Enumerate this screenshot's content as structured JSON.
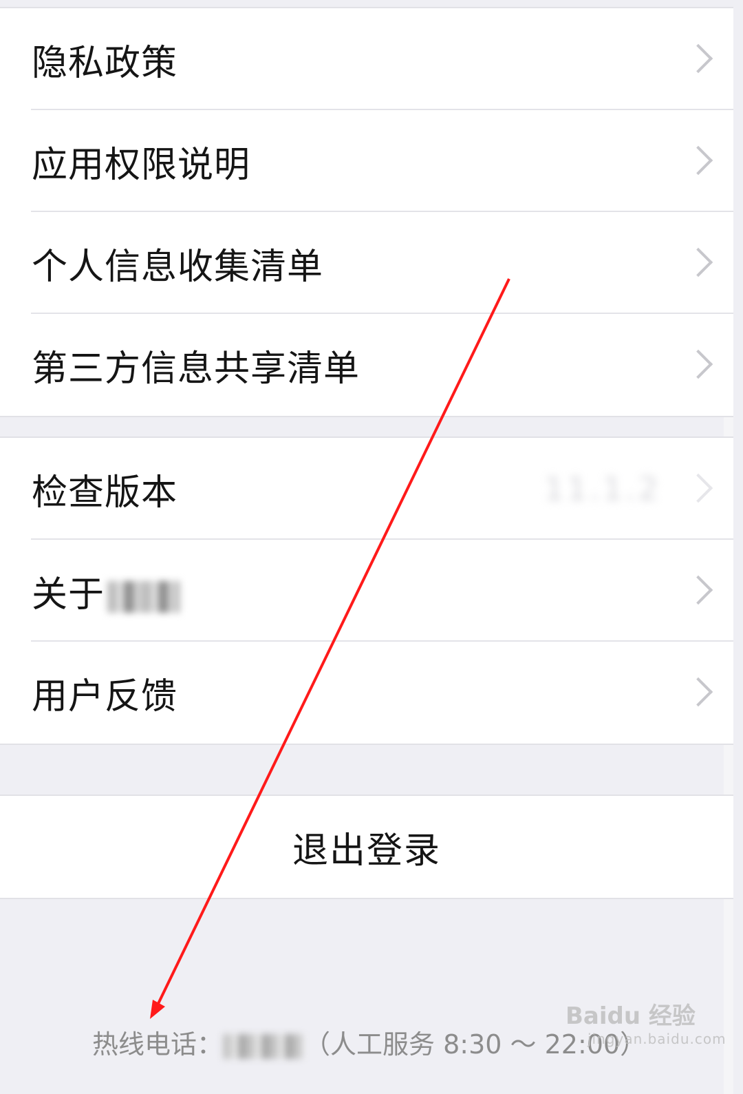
{
  "settings_group_1": {
    "items": [
      {
        "label": "隐私政策"
      },
      {
        "label": "应用权限说明"
      },
      {
        "label": "个人信息收集清单"
      },
      {
        "label": "第三方信息共享清单"
      }
    ]
  },
  "settings_group_2": {
    "items": [
      {
        "label": "检查版本",
        "value": "11.1.2"
      },
      {
        "label": "关于"
      },
      {
        "label": "用户反馈"
      }
    ]
  },
  "logout": {
    "label": "退出登录"
  },
  "footer": {
    "hotline_label": "热线电话：",
    "hotline_hours": "（人工服务 8:30 ～ 22:00）"
  },
  "watermark": {
    "brand": "Baidu 经验",
    "sub": "jingyan.baidu.com"
  },
  "colors": {
    "background": "#efeff4",
    "annotation_arrow": "#ff1a1a"
  }
}
